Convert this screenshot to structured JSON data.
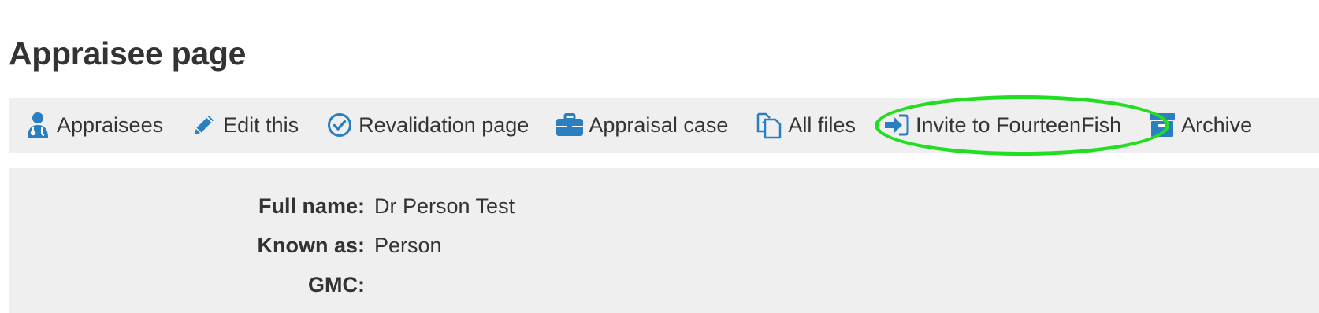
{
  "page": {
    "title": "Appraisee page"
  },
  "toolbar": {
    "items": [
      {
        "label": "Appraisees",
        "icon": "user-doctor-icon"
      },
      {
        "label": "Edit this",
        "icon": "pencil-icon"
      },
      {
        "label": "Revalidation page",
        "icon": "check-circle-icon"
      },
      {
        "label": "Appraisal case",
        "icon": "briefcase-icon"
      },
      {
        "label": "All files",
        "icon": "files-icon"
      },
      {
        "label": "Invite to FourteenFish",
        "icon": "sign-in-icon"
      },
      {
        "label": "Archive",
        "icon": "archive-box-icon"
      }
    ]
  },
  "details": {
    "full_name_label": "Full name:",
    "full_name_value": "Dr Person Test",
    "known_as_label": "Known as:",
    "known_as_value": "Person",
    "gmc_label": "GMC:",
    "gmc_value": ""
  },
  "colors": {
    "icon_blue": "#2a7fc1",
    "panel_bg": "#efefef",
    "text": "#333333",
    "highlight": "#22dd22"
  }
}
